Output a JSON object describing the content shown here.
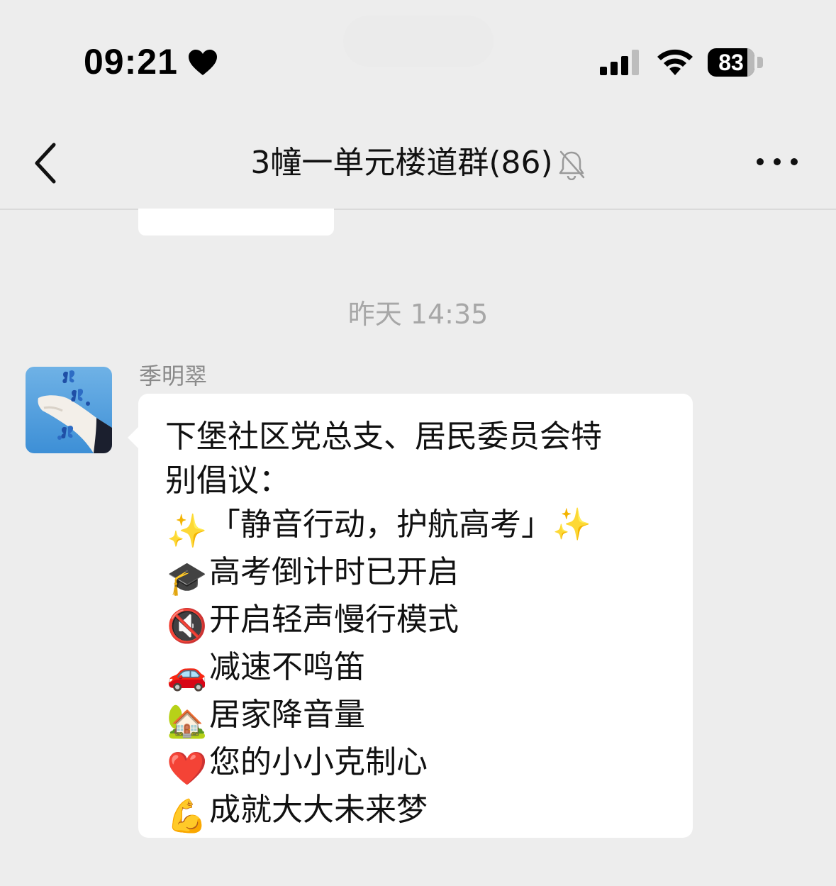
{
  "status_bar": {
    "time": "09:21",
    "heart_icon": "heart-icon",
    "signal_icon": "cellular-signal-icon",
    "wifi_icon": "wifi-icon",
    "battery_level": "83"
  },
  "nav": {
    "back_icon": "chevron-left-icon",
    "title": "3幢一单元楼道群(86)",
    "mute_icon": "bell-slash-icon",
    "more_icon": "more-dots-icon"
  },
  "chat": {
    "timestamp": "昨天 14:35",
    "message": {
      "sender": "季明翠",
      "avatar": "butterfly-hand-avatar",
      "lines": [
        {
          "emoji": "",
          "text": "下堡社区党总支、居民委员会特"
        },
        {
          "emoji": "",
          "text": "别倡议："
        },
        {
          "emoji": "✨",
          "text": "「静音行动，护航高考」✨"
        },
        {
          "emoji": "🎓",
          "text": "高考倒计时已开启"
        },
        {
          "emoji": "🔇",
          "text": "开启轻声慢行模式"
        },
        {
          "emoji": "🚗",
          "text": "减速不鸣笛"
        },
        {
          "emoji": "🏡",
          "text": "居家降音量"
        },
        {
          "emoji": "❤️",
          "text": "您的小小克制心"
        },
        {
          "emoji": "💪",
          "text": "成就大大未来梦"
        }
      ]
    }
  },
  "colors": {
    "background": "#ededed",
    "bubble": "#ffffff",
    "timestamp": "#a7a7a7"
  }
}
